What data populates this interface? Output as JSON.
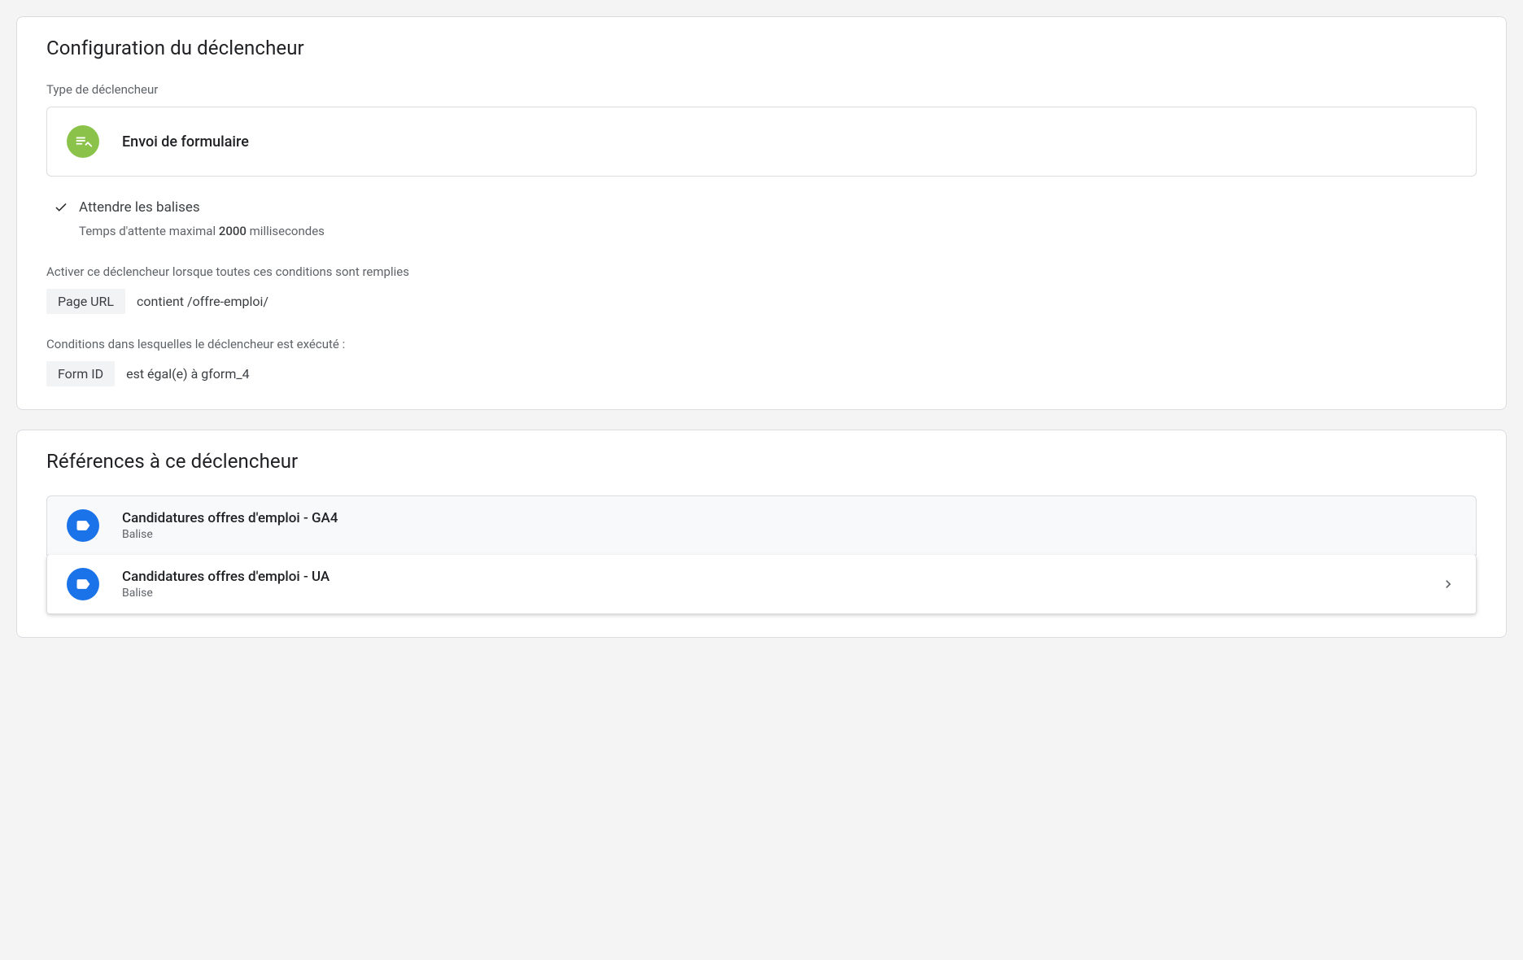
{
  "trigger_config": {
    "title": "Configuration du déclencheur",
    "type_label": "Type de déclencheur",
    "type_name": "Envoi de formulaire",
    "wait_for_tags": {
      "label": "Attendre les balises",
      "wait_prefix": "Temps d'attente maximal ",
      "wait_value": "2000",
      "wait_suffix": " millisecondes"
    },
    "conditions_activate": {
      "label": "Activer ce déclencheur lorsque toutes ces conditions sont remplies",
      "variable": "Page URL",
      "operator_value": "contient /offre-emploi/"
    },
    "conditions_fire": {
      "label": "Conditions dans lesquelles le déclencheur est exécuté :",
      "variable": "Form ID",
      "operator_value": "est égal(e) à gform_4"
    }
  },
  "references": {
    "title": "Références à ce déclencheur",
    "items": [
      {
        "name": "Candidatures offres d'emploi - GA4",
        "type": "Balise"
      },
      {
        "name": "Candidatures offres d'emploi - UA",
        "type": "Balise"
      }
    ]
  }
}
